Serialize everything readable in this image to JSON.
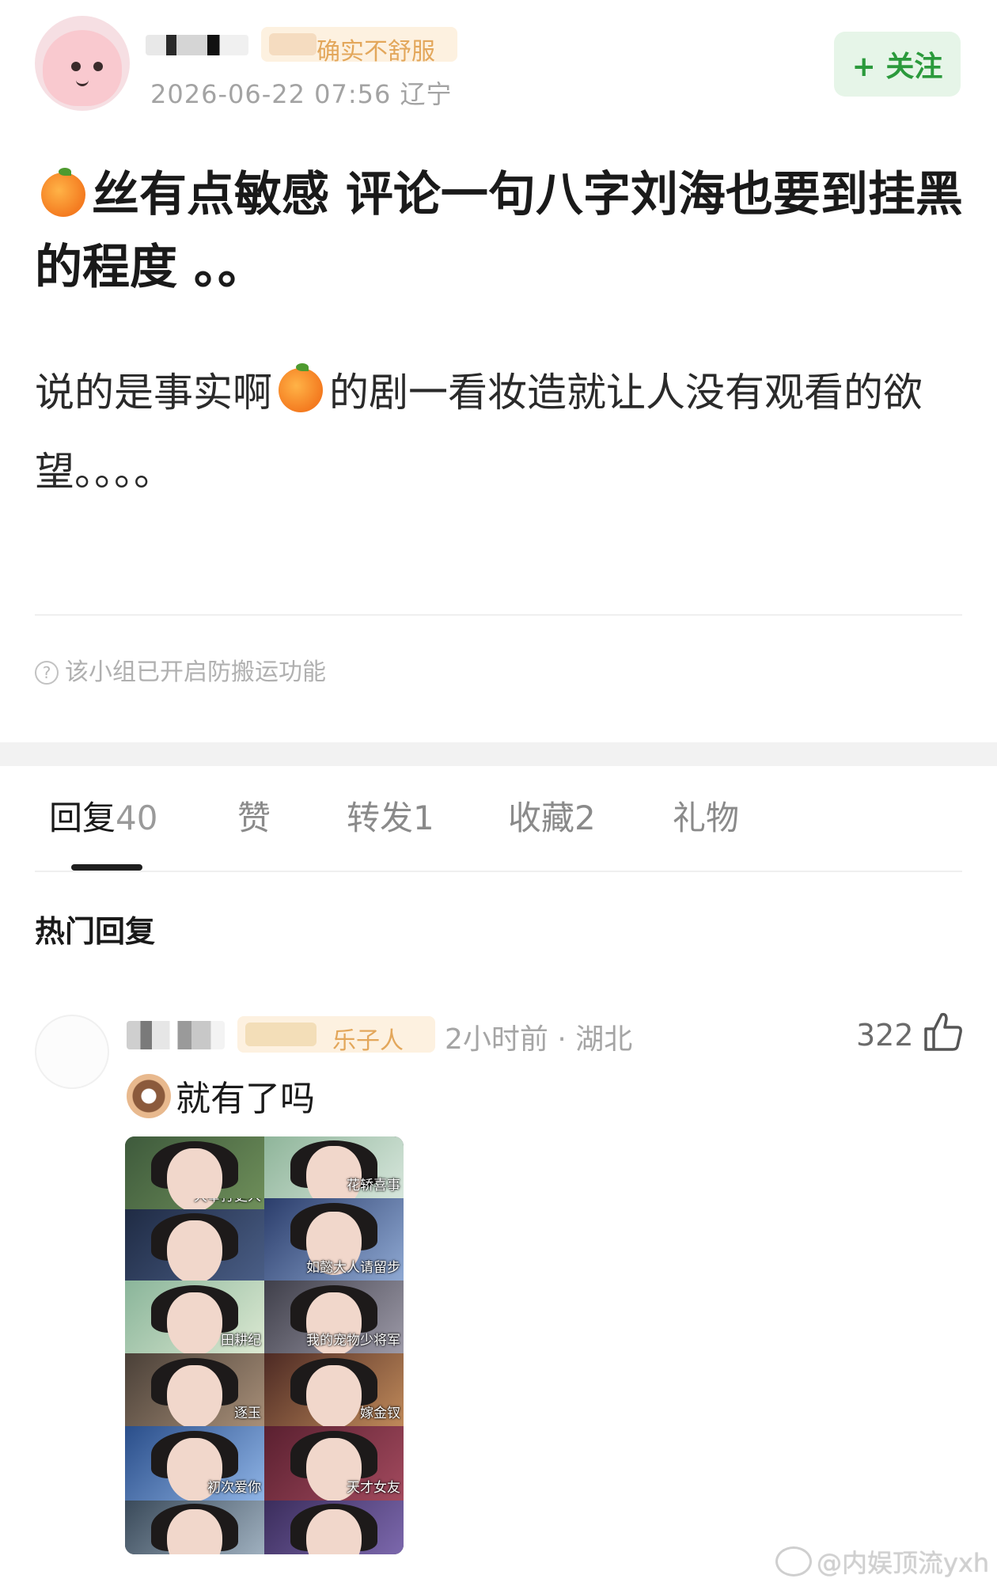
{
  "post": {
    "badge": "确实不舒服",
    "timestamp_location": "2026-06-22 07:56  辽宁",
    "follow_label": "+ 关注",
    "title_part1": "丝有点敏感 评论一句八字刘海也要到挂黑的程度 。。",
    "body_part1": "说的是事实啊",
    "body_part2": "的剧一看妆造就让人没有观看的欲望。。。。",
    "notice": "该小组已开启防搬运功能"
  },
  "tabs": [
    {
      "label": "回复",
      "count": "40"
    },
    {
      "label": "赞",
      "count": ""
    },
    {
      "label": "转发",
      "count": "1"
    },
    {
      "label": "收藏",
      "count": "2"
    },
    {
      "label": "礼物",
      "count": ""
    }
  ],
  "hot_replies_title": "热门回复",
  "comment": {
    "badge": "乐子人",
    "meta": "2小时前 · 湖北",
    "likes": "322",
    "text": "就有了吗",
    "image_labels": [
      "大奉打更人",
      "花轿喜事",
      "",
      "如懿大人请留步",
      "田耕纪",
      "我的宠物少将军",
      "逐玉",
      "嫁金钗",
      "初次爱你",
      "天才女友",
      "",
      ""
    ]
  },
  "watermark": "@内娱顶流yxh",
  "colors": {
    "follow_green": "#2b9a3c",
    "badge_orange": "#e3a75b",
    "meta_gray": "#a3a3a3"
  },
  "icons": [
    "orange-emoji-icon",
    "question-circle-icon",
    "thumbs-up-icon",
    "donut-emoji-icon",
    "weibo-icon"
  ]
}
